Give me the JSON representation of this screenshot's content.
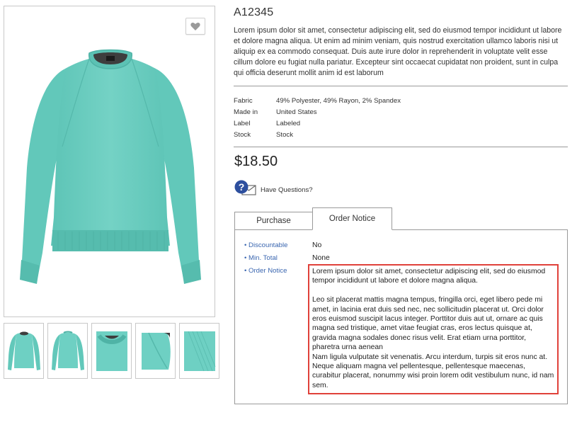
{
  "product": {
    "sku": "A12345",
    "description": "Lorem ipsum dolor sit amet, consectetur adipiscing elit, sed do eiusmod tempor incididunt ut labore et dolore magna aliqua. Ut enim ad minim veniam, quis nostrud exercitation ullamco laboris nisi ut aliquip ex ea commodo consequat. Duis aute irure dolor in reprehenderit in voluptate velit esse cillum dolore eu fugiat nulla pariatur. Excepteur sint occaecat cupidatat non proident, sunt in culpa qui officia deserunt mollit anim id est laborum",
    "price": "$18.50",
    "color": "#6ecdc0",
    "specs": [
      {
        "label": "Fabric",
        "value": "49% Polyester, 49% Rayon, 2% Spandex"
      },
      {
        "label": "Made in",
        "value": "United States"
      },
      {
        "label": "Label",
        "value": "Labeled"
      },
      {
        "label": "Stock",
        "value": "Stock"
      }
    ]
  },
  "icons": {
    "favorite": "heart-icon",
    "questions": "question-mail-icon"
  },
  "questions": {
    "label": "Have Questions?"
  },
  "thumbnails": [
    {
      "view": "front"
    },
    {
      "view": "back"
    },
    {
      "view": "collar-closeup"
    },
    {
      "view": "shoulder-closeup"
    },
    {
      "view": "cuff-closeup"
    }
  ],
  "tabs": [
    {
      "label": "Purchase",
      "active": false
    },
    {
      "label": "Order Notice",
      "active": true
    }
  ],
  "order_notice": {
    "fields": [
      {
        "label": "• Discountable",
        "value": "No"
      },
      {
        "label": "• Min. Total",
        "value": "None"
      },
      {
        "label": "• Order Notice"
      }
    ],
    "notice_p1": "Lorem ipsum dolor sit amet, consectetur adipiscing elit, sed do eiusmod tempor incididunt ut labore et dolore magna aliqua.",
    "notice_p2": "Leo sit placerat mattis magna tempus, fringilla orci, eget libero pede mi amet, in lacinia erat duis sed nec, nec sollicitudin placerat ut. Orci dolor eros euismod suscipit lacus integer. Porttitor duis aut ut, ornare ac quis magna sed tristique, amet vitae feugiat cras, eros lectus quisque at, gravida magna sodales donec risus velit. Erat etiam urna porttitor, pharetra urna aenean",
    "notice_p3": "Nam ligula vulputate sit venenatis. Arcu interdum, turpis sit eros nunc at. Neque aliquam magna vel pellentesque, pellentesque maecenas, curabitur placerat, nonummy wisi proin lorem odit vestibulum nunc, id nam sem.",
    "highlight_color": "#e0413a"
  }
}
